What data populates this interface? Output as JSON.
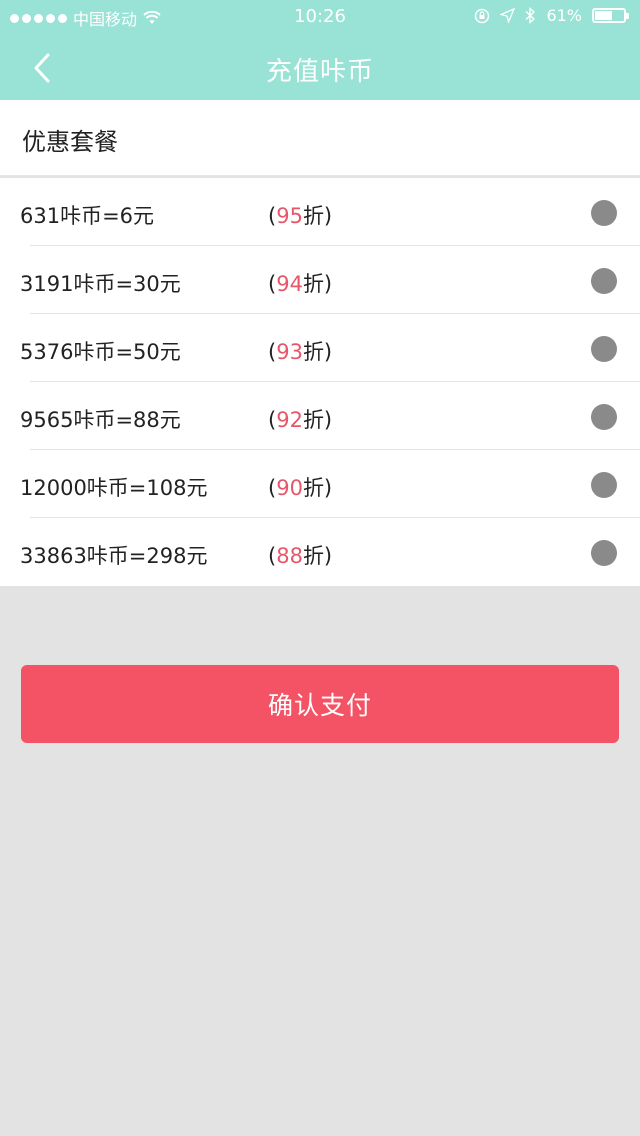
{
  "status_bar": {
    "carrier": "中国移动",
    "time": "10:26",
    "battery_percent": "61%",
    "battery_level": 0.61
  },
  "nav": {
    "title": "充值咔币",
    "back_icon": "chevron-left-icon"
  },
  "section": {
    "title": "优惠套餐"
  },
  "packages": [
    {
      "label": "631咔币=6元",
      "open": "(",
      "discount": "95",
      "suffix": "折)",
      "selected": false
    },
    {
      "label": "3191咔币=30元",
      "open": "(",
      "discount": "94",
      "suffix": "折)",
      "selected": false
    },
    {
      "label": "5376咔币=50元",
      "open": "(",
      "discount": "93",
      "suffix": "折)",
      "selected": false
    },
    {
      "label": "9565咔币=88元",
      "open": "(",
      "discount": "92",
      "suffix": "折)",
      "selected": false
    },
    {
      "label": "12000咔币=108元",
      "open": "(",
      "discount": "90",
      "suffix": "折)",
      "selected": false
    },
    {
      "label": "33863咔币=298元",
      "open": "(",
      "discount": "88",
      "suffix": "折)",
      "selected": false
    }
  ],
  "confirm": {
    "label": "确认支付"
  },
  "colors": {
    "header": "#98e3d6",
    "accent": "#f45265",
    "discount": "#e8566a",
    "background": "#e3e3e3"
  }
}
